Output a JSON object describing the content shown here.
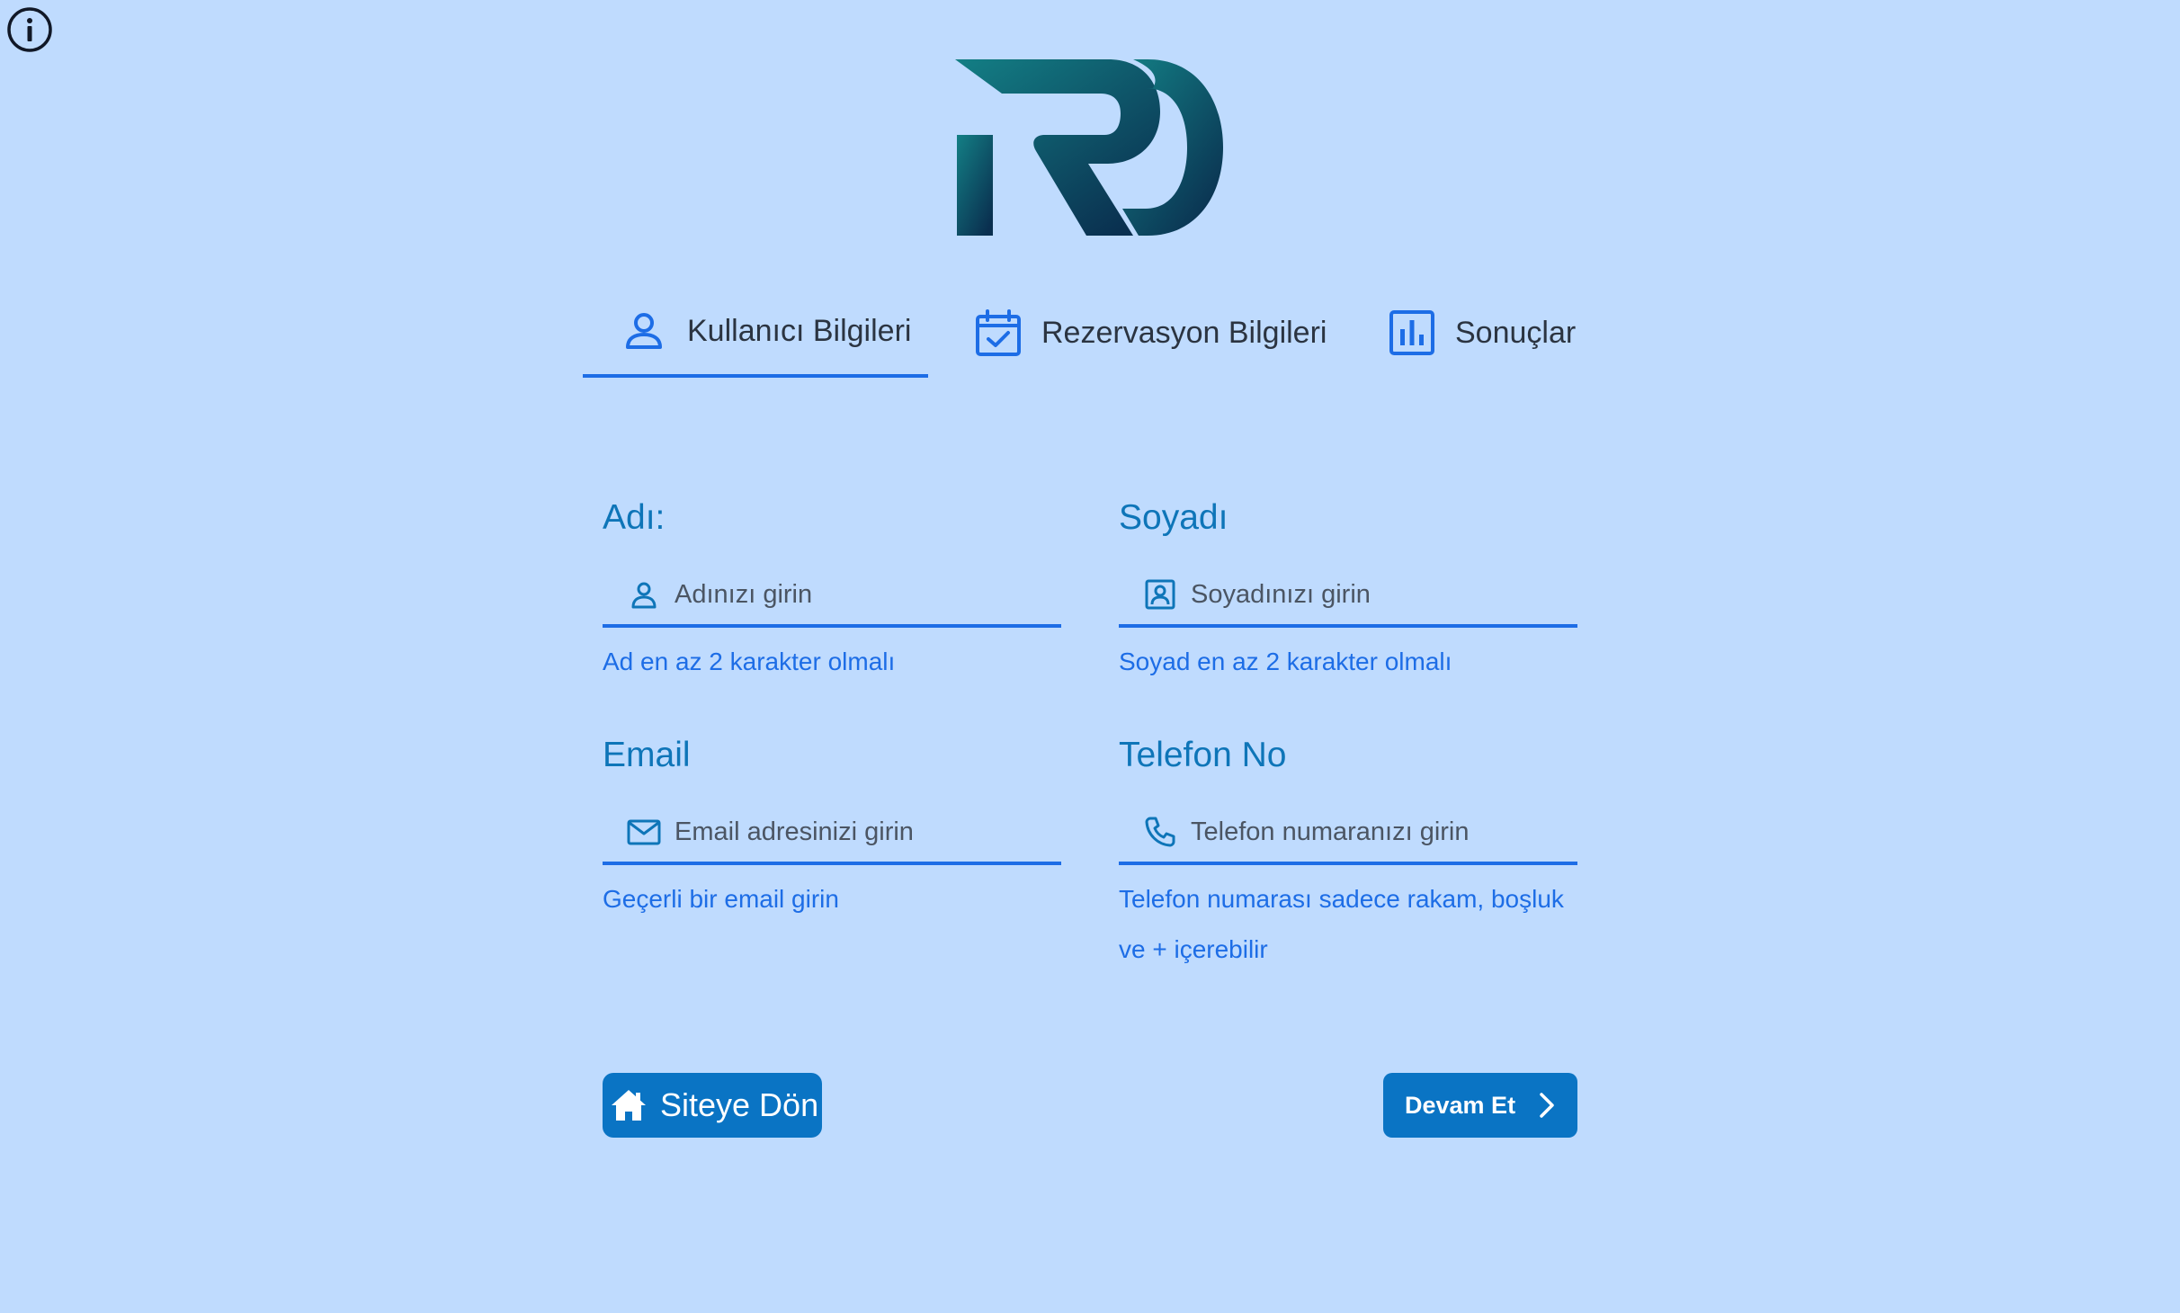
{
  "info": {
    "icon": "info-circle-icon"
  },
  "logo": {
    "text": "RD"
  },
  "tabs": [
    {
      "label": "Kullanıcı Bilgileri",
      "icon": "user-icon",
      "active": true
    },
    {
      "label": "Rezervasyon Bilgileri",
      "icon": "calendar-check-icon",
      "active": false
    },
    {
      "label": "Sonuçlar",
      "icon": "bar-chart-icon",
      "active": false
    }
  ],
  "form": {
    "first_name": {
      "label": "Adı:",
      "placeholder": "Adınızı girin",
      "value": "",
      "hint": "Ad en az 2 karakter olmalı",
      "icon": "user-icon"
    },
    "last_name": {
      "label": "Soyadı",
      "placeholder": "Soyadınızı girin",
      "value": "",
      "hint": "Soyad en az 2 karakter olmalı",
      "icon": "contact-card-icon"
    },
    "email": {
      "label": "Email",
      "placeholder": "Email adresinizi girin",
      "value": "",
      "hint": "Geçerli bir email girin",
      "icon": "mail-icon"
    },
    "phone": {
      "label": "Telefon No",
      "placeholder": "Telefon numaranızı girin",
      "value": "",
      "hint": "Telefon numarası sadece rakam, boşluk ve + içerebilir",
      "icon": "phone-icon"
    }
  },
  "buttons": {
    "home_label": "Siteye Dön",
    "home_icon": "home-icon",
    "next_label": "Devam Et",
    "next_icon": "chevron-right-icon"
  },
  "colors": {
    "background": "#bfdbfe",
    "accent": "#1d6de6",
    "label": "#0e75b8",
    "button": "#0a74c4",
    "logo_gradient_start": "#137f85",
    "logo_gradient_end": "#0a2f4f"
  }
}
